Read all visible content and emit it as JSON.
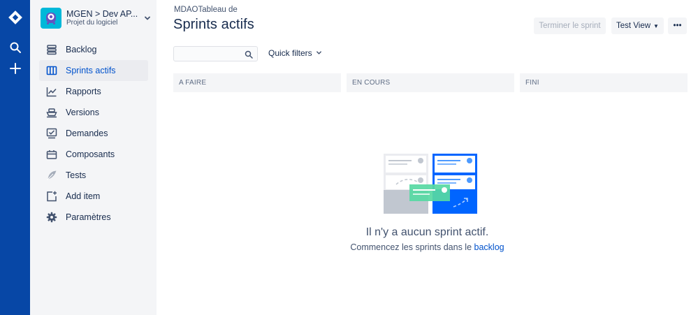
{
  "global_nav": {
    "logo_icon": "jira-logo-icon",
    "search_icon": "search-icon",
    "create_icon": "plus-icon",
    "background": "#0747A6"
  },
  "project": {
    "name": "MGEN > Dev AP...",
    "type": "Projet du logiciel",
    "avatar_color": "#00B8D9"
  },
  "sidebar": {
    "items": [
      {
        "label": "Backlog",
        "icon": "backlog-icon",
        "active": false
      },
      {
        "label": "Sprints actifs",
        "icon": "board-icon",
        "active": true
      },
      {
        "label": "Rapports",
        "icon": "chart-icon",
        "active": false
      },
      {
        "label": "Versions",
        "icon": "ship-icon",
        "active": false
      },
      {
        "label": "Demandes",
        "icon": "issues-icon",
        "active": false
      },
      {
        "label": "Composants",
        "icon": "component-icon",
        "active": false
      },
      {
        "label": "Tests",
        "icon": "feather-icon",
        "active": false
      },
      {
        "label": "Add item",
        "icon": "add-item-icon",
        "active": false
      },
      {
        "label": "Paramètres",
        "icon": "gear-icon",
        "active": false
      }
    ]
  },
  "header": {
    "breadcrumb": "MDAOTableau de",
    "title": "Sprints actifs",
    "complete_sprint_label": "Terminer le sprint",
    "view_label": "Test View",
    "more_label": "•••"
  },
  "filters": {
    "search_value": "",
    "search_placeholder": "",
    "quick_filters_label": "Quick filters"
  },
  "columns": [
    {
      "label": "A FAIRE"
    },
    {
      "label": "EN COURS"
    },
    {
      "label": "FINI"
    }
  ],
  "empty_state": {
    "title": "Il n'y a aucun sprint actif.",
    "subtitle": "Commencez les sprints dans le",
    "link_label": "backlog"
  },
  "colors": {
    "accent": "#0052CC",
    "sidebar_bg": "#F4F5F7",
    "text": "#172B4D"
  }
}
